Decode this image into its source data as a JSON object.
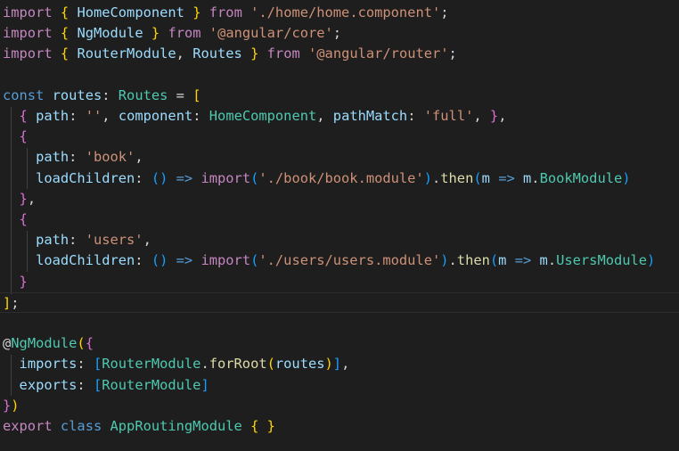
{
  "editor": {
    "lines": [
      [
        {
          "t": "import",
          "c": "kw"
        },
        {
          "t": " ",
          "c": "pu"
        },
        {
          "t": "{",
          "c": "b1"
        },
        {
          "t": " ",
          "c": "pu"
        },
        {
          "t": "HomeComponent",
          "c": "va"
        },
        {
          "t": " ",
          "c": "pu"
        },
        {
          "t": "}",
          "c": "b1"
        },
        {
          "t": " ",
          "c": "pu"
        },
        {
          "t": "from",
          "c": "kw"
        },
        {
          "t": " ",
          "c": "pu"
        },
        {
          "t": "'./home/home.component'",
          "c": "sr"
        },
        {
          "t": ";",
          "c": "pu"
        }
      ],
      [
        {
          "t": "import",
          "c": "kw"
        },
        {
          "t": " ",
          "c": "pu"
        },
        {
          "t": "{",
          "c": "b1"
        },
        {
          "t": " ",
          "c": "pu"
        },
        {
          "t": "NgModule",
          "c": "va"
        },
        {
          "t": " ",
          "c": "pu"
        },
        {
          "t": "}",
          "c": "b1"
        },
        {
          "t": " ",
          "c": "pu"
        },
        {
          "t": "from",
          "c": "kw"
        },
        {
          "t": " ",
          "c": "pu"
        },
        {
          "t": "'@angular/core'",
          "c": "sr"
        },
        {
          "t": ";",
          "c": "pu"
        }
      ],
      [
        {
          "t": "import",
          "c": "kw"
        },
        {
          "t": " ",
          "c": "pu"
        },
        {
          "t": "{",
          "c": "b1"
        },
        {
          "t": " ",
          "c": "pu"
        },
        {
          "t": "RouterModule",
          "c": "va"
        },
        {
          "t": ", ",
          "c": "pu"
        },
        {
          "t": "Routes",
          "c": "va"
        },
        {
          "t": " ",
          "c": "pu"
        },
        {
          "t": "}",
          "c": "b1"
        },
        {
          "t": " ",
          "c": "pu"
        },
        {
          "t": "from",
          "c": "kw"
        },
        {
          "t": " ",
          "c": "pu"
        },
        {
          "t": "'@angular/router'",
          "c": "sr"
        },
        {
          "t": ";",
          "c": "pu"
        }
      ],
      [],
      [
        {
          "t": "const",
          "c": "st"
        },
        {
          "t": " ",
          "c": "pu"
        },
        {
          "t": "routes",
          "c": "va"
        },
        {
          "t": ": ",
          "c": "pu"
        },
        {
          "t": "Routes",
          "c": "ty"
        },
        {
          "t": " = ",
          "c": "pu"
        },
        {
          "t": "[",
          "c": "b1"
        }
      ],
      [
        {
          "t": "  ",
          "c": "pu"
        },
        {
          "t": "{",
          "c": "b2"
        },
        {
          "t": " ",
          "c": "pu"
        },
        {
          "t": "path",
          "c": "va"
        },
        {
          "t": ": ",
          "c": "pu"
        },
        {
          "t": "''",
          "c": "sr"
        },
        {
          "t": ", ",
          "c": "pu"
        },
        {
          "t": "component",
          "c": "va"
        },
        {
          "t": ": ",
          "c": "pu"
        },
        {
          "t": "HomeComponent",
          "c": "ty"
        },
        {
          "t": ", ",
          "c": "pu"
        },
        {
          "t": "pathMatch",
          "c": "va"
        },
        {
          "t": ": ",
          "c": "pu"
        },
        {
          "t": "'full'",
          "c": "sr"
        },
        {
          "t": ", ",
          "c": "pu"
        },
        {
          "t": "}",
          "c": "b2"
        },
        {
          "t": ",",
          "c": "pu"
        }
      ],
      [
        {
          "t": "  ",
          "c": "pu"
        },
        {
          "t": "{",
          "c": "b2"
        }
      ],
      [
        {
          "t": "    ",
          "c": "pu"
        },
        {
          "t": "path",
          "c": "va"
        },
        {
          "t": ": ",
          "c": "pu"
        },
        {
          "t": "'book'",
          "c": "sr"
        },
        {
          "t": ",",
          "c": "pu"
        }
      ],
      [
        {
          "t": "    ",
          "c": "pu"
        },
        {
          "t": "loadChildren",
          "c": "va"
        },
        {
          "t": ": ",
          "c": "pu"
        },
        {
          "t": "()",
          "c": "b3"
        },
        {
          "t": " ",
          "c": "pu"
        },
        {
          "t": "=>",
          "c": "op"
        },
        {
          "t": " ",
          "c": "pu"
        },
        {
          "t": "import",
          "c": "kw"
        },
        {
          "t": "(",
          "c": "b3"
        },
        {
          "t": "'./book/book.module'",
          "c": "sr"
        },
        {
          "t": ")",
          "c": "b3"
        },
        {
          "t": ".",
          "c": "pu"
        },
        {
          "t": "then",
          "c": "fn"
        },
        {
          "t": "(",
          "c": "b3"
        },
        {
          "t": "m",
          "c": "va"
        },
        {
          "t": " ",
          "c": "pu"
        },
        {
          "t": "=>",
          "c": "op"
        },
        {
          "t": " ",
          "c": "pu"
        },
        {
          "t": "m",
          "c": "va"
        },
        {
          "t": ".",
          "c": "pu"
        },
        {
          "t": "BookModule",
          "c": "ty"
        },
        {
          "t": ")",
          "c": "b3"
        }
      ],
      [
        {
          "t": "  ",
          "c": "pu"
        },
        {
          "t": "}",
          "c": "b2"
        },
        {
          "t": ",",
          "c": "pu"
        }
      ],
      [
        {
          "t": "  ",
          "c": "pu"
        },
        {
          "t": "{",
          "c": "b2"
        }
      ],
      [
        {
          "t": "    ",
          "c": "pu"
        },
        {
          "t": "path",
          "c": "va"
        },
        {
          "t": ": ",
          "c": "pu"
        },
        {
          "t": "'users'",
          "c": "sr"
        },
        {
          "t": ",",
          "c": "pu"
        }
      ],
      [
        {
          "t": "    ",
          "c": "pu"
        },
        {
          "t": "loadChildren",
          "c": "va"
        },
        {
          "t": ": ",
          "c": "pu"
        },
        {
          "t": "()",
          "c": "b3"
        },
        {
          "t": " ",
          "c": "pu"
        },
        {
          "t": "=>",
          "c": "op"
        },
        {
          "t": " ",
          "c": "pu"
        },
        {
          "t": "import",
          "c": "kw"
        },
        {
          "t": "(",
          "c": "b3"
        },
        {
          "t": "'./users/users.module'",
          "c": "sr"
        },
        {
          "t": ")",
          "c": "b3"
        },
        {
          "t": ".",
          "c": "pu"
        },
        {
          "t": "then",
          "c": "fn"
        },
        {
          "t": "(",
          "c": "b3"
        },
        {
          "t": "m",
          "c": "va"
        },
        {
          "t": " ",
          "c": "pu"
        },
        {
          "t": "=>",
          "c": "op"
        },
        {
          "t": " ",
          "c": "pu"
        },
        {
          "t": "m",
          "c": "va"
        },
        {
          "t": ".",
          "c": "pu"
        },
        {
          "t": "UsersModule",
          "c": "ty"
        },
        {
          "t": ")",
          "c": "b3"
        }
      ],
      [
        {
          "t": "  ",
          "c": "pu"
        },
        {
          "t": "}",
          "c": "b2"
        }
      ],
      [
        {
          "t": "]",
          "c": "b1"
        },
        {
          "t": ";",
          "c": "pu"
        }
      ],
      [],
      [
        {
          "t": "@",
          "c": "pu"
        },
        {
          "t": "NgModule",
          "c": "ty"
        },
        {
          "t": "(",
          "c": "b1"
        },
        {
          "t": "{",
          "c": "b2"
        }
      ],
      [
        {
          "t": "  ",
          "c": "pu"
        },
        {
          "t": "imports",
          "c": "va"
        },
        {
          "t": ": ",
          "c": "pu"
        },
        {
          "t": "[",
          "c": "b3"
        },
        {
          "t": "RouterModule",
          "c": "ty"
        },
        {
          "t": ".",
          "c": "pu"
        },
        {
          "t": "forRoot",
          "c": "fn"
        },
        {
          "t": "(",
          "c": "b1"
        },
        {
          "t": "routes",
          "c": "va"
        },
        {
          "t": ")",
          "c": "b1"
        },
        {
          "t": "]",
          "c": "b3"
        },
        {
          "t": ",",
          "c": "pu"
        }
      ],
      [
        {
          "t": "  ",
          "c": "pu"
        },
        {
          "t": "exports",
          "c": "va"
        },
        {
          "t": ": ",
          "c": "pu"
        },
        {
          "t": "[",
          "c": "b3"
        },
        {
          "t": "RouterModule",
          "c": "ty"
        },
        {
          "t": "]",
          "c": "b3"
        }
      ],
      [
        {
          "t": "}",
          "c": "b2"
        },
        {
          "t": ")",
          "c": "b1"
        }
      ],
      [
        {
          "t": "export",
          "c": "kw"
        },
        {
          "t": " ",
          "c": "pu"
        },
        {
          "t": "class",
          "c": "st"
        },
        {
          "t": " ",
          "c": "pu"
        },
        {
          "t": "AppRoutingModule",
          "c": "ty"
        },
        {
          "t": " ",
          "c": "pu"
        },
        {
          "t": "{",
          "c": "b1"
        },
        {
          "t": " ",
          "c": "pu"
        },
        {
          "t": "}",
          "c": "b1"
        }
      ]
    ],
    "current_line_index": 14
  }
}
